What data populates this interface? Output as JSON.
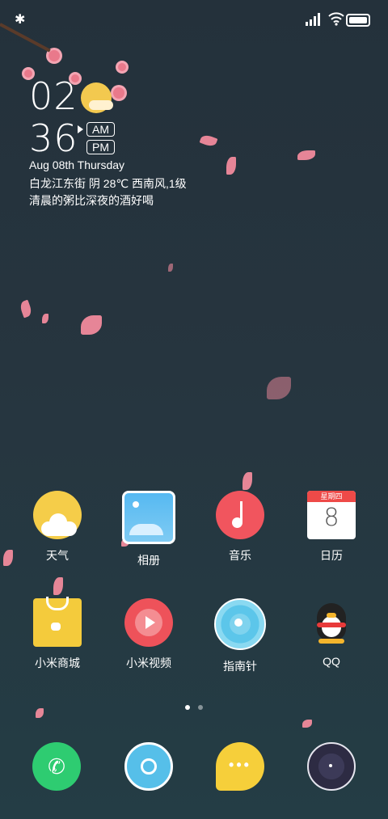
{
  "status_bar": {
    "bluetooth_icon": "bluetooth-icon",
    "signal_icon": "signal-icon",
    "wifi_icon": "wifi-icon",
    "battery_icon": "battery-icon"
  },
  "clock": {
    "hour": "02",
    "minute": "36",
    "am": "AM",
    "pm": "PM",
    "selected": "AM"
  },
  "widget": {
    "date": "Aug 08th Thursday",
    "weather": "白龙江东街 阴 28℃ 西南风,1级",
    "quote": "清晨的粥比深夜的酒好喝"
  },
  "apps": [
    {
      "label": "天气",
      "icon": "weather-icon"
    },
    {
      "label": "相册",
      "icon": "gallery-icon"
    },
    {
      "label": "音乐",
      "icon": "music-icon"
    },
    {
      "label": "日历",
      "icon": "calendar-icon",
      "calendar_header": "星期四",
      "calendar_day": "8"
    },
    {
      "label": "小米商城",
      "icon": "mi-store-icon"
    },
    {
      "label": "小米视频",
      "icon": "mi-video-icon"
    },
    {
      "label": "指南针",
      "icon": "compass-icon"
    },
    {
      "label": "QQ",
      "icon": "qq-icon"
    }
  ],
  "page_indicator": {
    "pages": 2,
    "current": 1
  },
  "dock": [
    {
      "icon": "phone-icon"
    },
    {
      "icon": "camera-icon"
    },
    {
      "icon": "messages-icon"
    },
    {
      "icon": "browser-icon"
    }
  ],
  "colors": {
    "phone": "#2ecc71",
    "music": "#f1555e",
    "weather": "#f5cd49",
    "petal": "#f08a9c"
  }
}
